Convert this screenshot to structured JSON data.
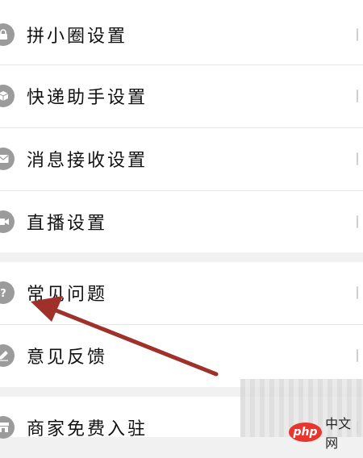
{
  "settings_list": {
    "items": [
      {
        "label": "拼小圈设置",
        "icon": "lock-icon"
      },
      {
        "label": "快递助手设置",
        "icon": "package-icon"
      },
      {
        "label": "消息接收设置",
        "icon": "envelope-icon"
      },
      {
        "label": "直播设置",
        "icon": "video-camera-icon"
      },
      {
        "label": "常见问题",
        "icon": "question-icon"
      },
      {
        "label": "意见反馈",
        "icon": "edit-pencil-icon"
      },
      {
        "label": "商家免费入驻",
        "icon": "store-icon"
      }
    ]
  },
  "watermark": {
    "logo_text": "php",
    "site_text": "中文网"
  },
  "colors": {
    "arrow": "#a0302a",
    "icon_bg": "#9b9b9b",
    "php_red": "#e8362e"
  }
}
